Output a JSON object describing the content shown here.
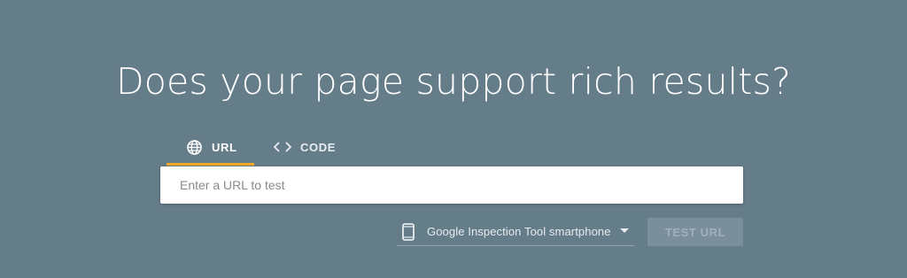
{
  "headline": "Does your page support rich results?",
  "tabs": [
    {
      "label": "URL",
      "icon": "globe-icon",
      "selected": true
    },
    {
      "label": "CODE",
      "icon": "code-icon",
      "selected": false
    }
  ],
  "url_input": {
    "value": "",
    "placeholder": "Enter a URL to test"
  },
  "device_select": {
    "icon": "smartphone-icon",
    "selected": "Google Inspection Tool smartphone"
  },
  "test_button": {
    "label": "TEST URL",
    "disabled": true
  },
  "colors": {
    "background": "#657c89",
    "accent": "#f4a629",
    "text": "#ffffff"
  }
}
